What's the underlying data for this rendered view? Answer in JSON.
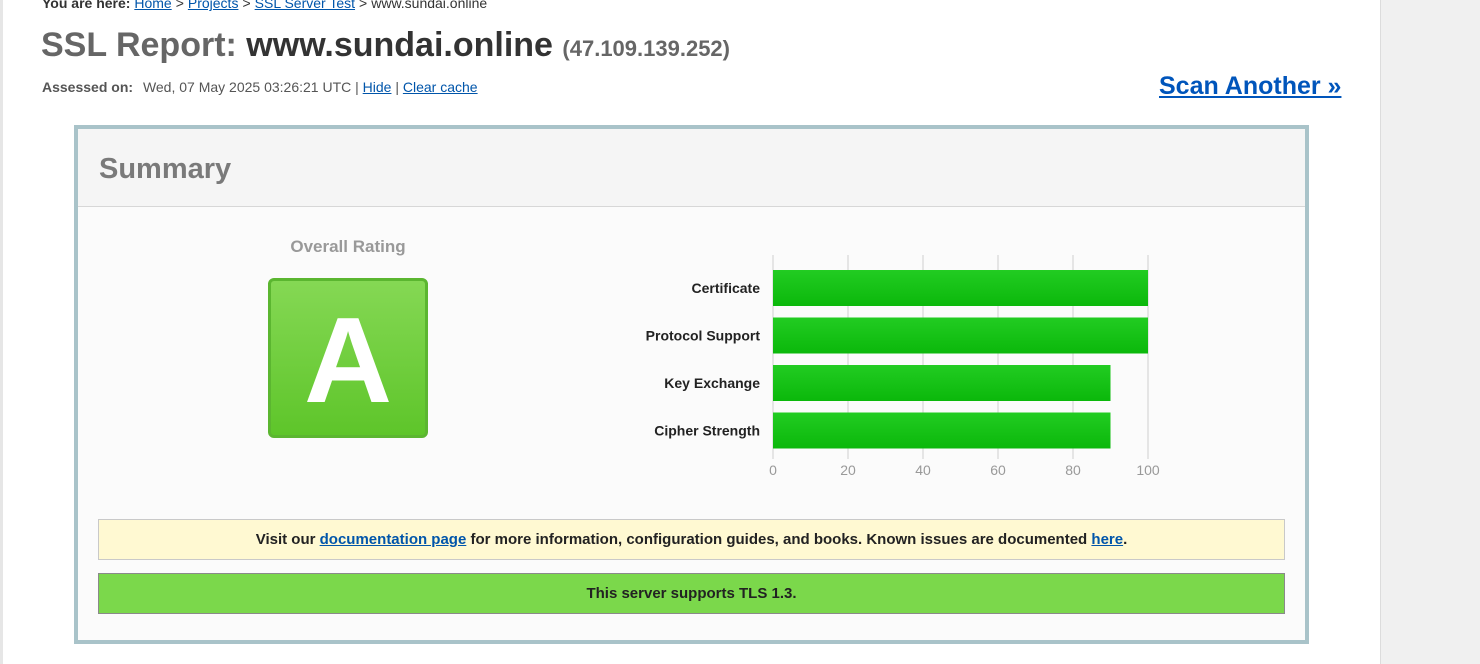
{
  "breadcrumb": {
    "label": "You are here:",
    "home": "Home",
    "projects": "Projects",
    "ssl_test": "SSL Server Test",
    "current": "www.sundai.online",
    "sep": ">"
  },
  "report": {
    "title_prefix": "SSL Report:",
    "host": "www.sundai.online",
    "ip": "(47.109.139.252)",
    "assessed_label": "Assessed on:",
    "assessed_date": "Wed, 07 May 2025 03:26:21 UTC",
    "pipe": "|",
    "hide": "Hide",
    "clear_cache": "Clear cache",
    "scan_another": "Scan Another »"
  },
  "summary": {
    "title": "Summary",
    "overall_label": "Overall Rating",
    "grade": "A",
    "grade_color": "#6cce3a"
  },
  "chart_data": {
    "type": "bar",
    "orientation": "horizontal",
    "categories": [
      "Certificate",
      "Protocol Support",
      "Key Exchange",
      "Cipher Strength"
    ],
    "values": [
      100,
      100,
      90,
      90
    ],
    "xlim": [
      0,
      100
    ],
    "ticks": [
      0,
      20,
      40,
      60,
      80,
      100
    ],
    "grid": true,
    "bar_color": "#0bb80b"
  },
  "notices": {
    "doc_before": "Visit our ",
    "doc_link": "documentation page",
    "doc_middle": " for more information, configuration guides, and books. Known issues are documented ",
    "doc_here": "here",
    "doc_end": ".",
    "tls": "This server supports TLS 1.3."
  }
}
